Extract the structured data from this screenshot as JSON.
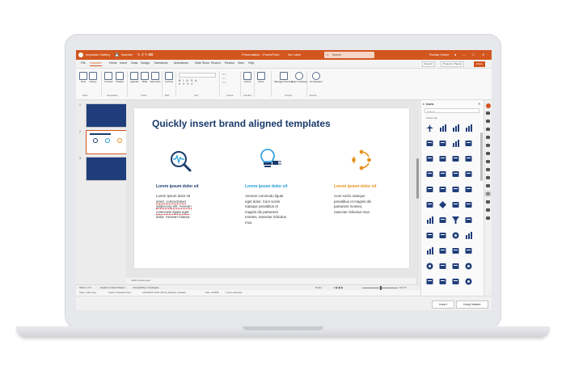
{
  "app": {
    "title": "empower Gallery",
    "toolbar_text": "Number",
    "doc_title": "Presentation - PowerPoint",
    "sensitivity": "No Label",
    "search_placeholder": "Search",
    "user": "Florian Huber"
  },
  "menubar": {
    "items": [
      "File",
      "empower",
      "Home",
      "Insert",
      "Draw",
      "Design",
      "Transitions",
      "Animations",
      "Slide Show",
      "Record",
      "Review",
      "View",
      "Help"
    ],
    "active_index": 1,
    "record_label": "Record",
    "present_label": "Present in Teams",
    "share_label": "Share"
  },
  "ribbon": {
    "buttons": [
      {
        "label": "New"
      },
      {
        "label": "Library"
      },
      {
        "label": "Convert"
      },
      {
        "label": "Tracker"
      },
      {
        "label": "Agenda"
      },
      {
        "label": "Slide"
      },
      {
        "label": "Elements"
      },
      {
        "label": "Format"
      },
      {
        "label": "Check"
      },
      {
        "label": "Store"
      },
      {
        "label": "Managed Service"
      },
      {
        "label": "Help & Settings"
      },
      {
        "label": "AI Assistant"
      }
    ],
    "groups": [
      "Start",
      "Templates",
      "Insert",
      "Edit",
      "Text",
      "Check",
      "Finalize",
      "Library",
      "Extras"
    ]
  },
  "thumbnails": {
    "numbers": [
      "1",
      "2",
      "3"
    ],
    "selected": 2
  },
  "slide": {
    "title": "Quickly insert brand aligned templates",
    "columns": [
      {
        "heading": "Lorem ipsum dolor sit",
        "heading_color": "#1a3a6b",
        "icon": "search-pulse-icon",
        "lines": [
          "Lorem ipsum dolor sit",
          "amet, consectetuer",
          "adipiscing elit. Aenean",
          "commodo ligula eget",
          "dolor. Aenean massa."
        ]
      },
      {
        "heading": "Lorem ipsum dolor sit",
        "heading_color": "#1f9ad6",
        "icon": "lightbulb-plug-icon",
        "lines": [
          "Aenean commodo ligula",
          "eget dolor. Cum sociis",
          "natoque penatibus et",
          "magnis dis parturient",
          "montes, nascetur ridiculus",
          "mus."
        ]
      },
      {
        "heading": "Lorem ipsum dolor sit",
        "heading_color": "#e8901e",
        "icon": "cycle-icon",
        "lines": [
          "Cum sociis natoque",
          "penatibus et magnis dis",
          "parturient montes,",
          "nascetur ridiculus mus."
        ]
      }
    ]
  },
  "notes": {
    "placeholder": "Click to add notes"
  },
  "icons_panel": {
    "title": "Icons",
    "search_placeholder": "Search",
    "filter": "Fusion Sp.",
    "colors": {
      "primary": "#1f3d7a"
    }
  },
  "status": {
    "slide": "Slide 1 of 3",
    "lang": "English (United States)",
    "accessibility": "Accessibility: Investigate",
    "zoom": "101 %",
    "notes_label": "Notes"
  },
  "tags": {
    "tags_label": "Tags: Add a tag",
    "author": "Author: Deleted User",
    "modified": "1/23/2023 10:01 AM by Stephen Hutsam",
    "size": "Size: 222KB",
    "selected": "1 Item selected"
  },
  "footer": {
    "insert_label": "Insert",
    "keep_master_label": "Keep Master"
  },
  "colors": {
    "accent": "#d2561e",
    "navy": "#1a3a6b",
    "blue": "#1f9ad6",
    "orange": "#e8901e"
  }
}
